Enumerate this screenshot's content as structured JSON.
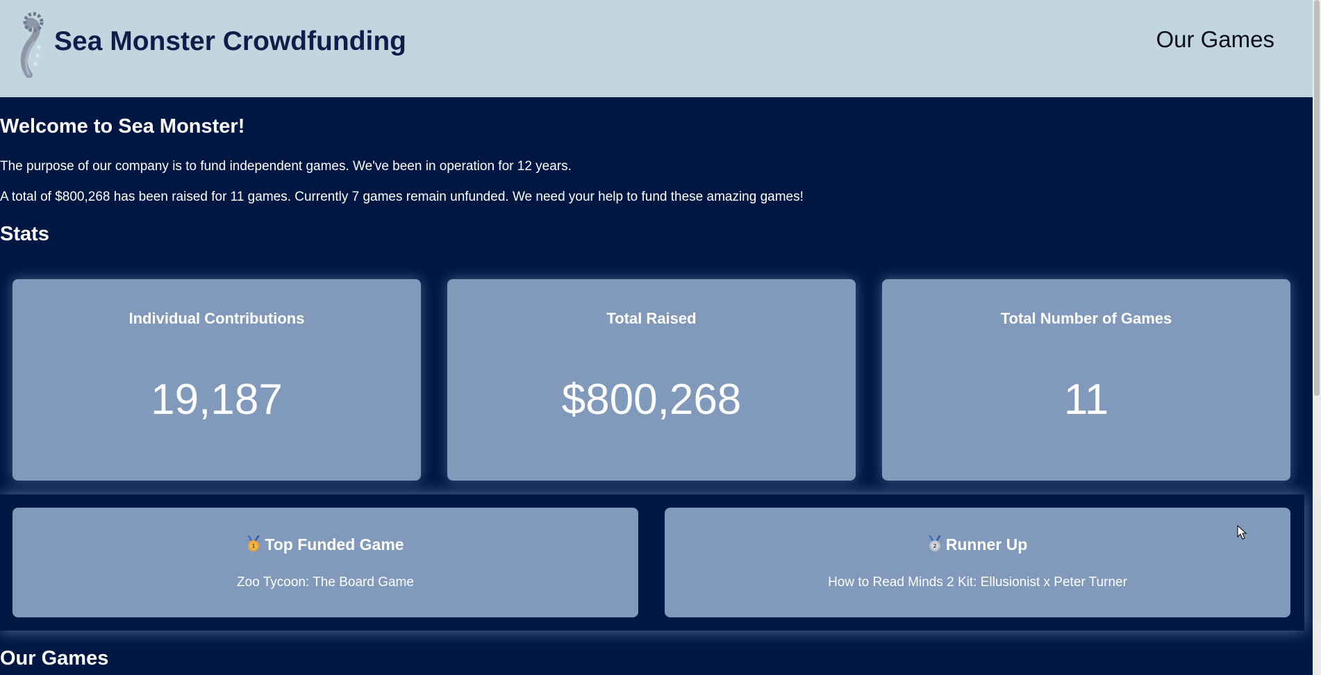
{
  "header": {
    "site_title": "Sea Monster Crowdfunding",
    "nav_link": "Our Games"
  },
  "intro": {
    "heading": "Welcome to Sea Monster!",
    "purpose": "The purpose of our company is to fund independent games. We've been in operation for 12 years.",
    "summary": "A total of $800,268 has been raised for 11 games. Currently 7 games remain unfunded. We need your help to fund these amazing games!"
  },
  "stats": {
    "heading": "Stats",
    "items": [
      {
        "label": "Individual Contributions",
        "value": "19,187"
      },
      {
        "label": "Total Raised",
        "value": "$800,268"
      },
      {
        "label": "Total Number of Games",
        "value": "11"
      }
    ]
  },
  "top_games": {
    "first": {
      "title": "Top Funded Game",
      "game": "Zoo Tycoon: The Board Game",
      "medal_number": "1"
    },
    "second": {
      "title": "Runner Up",
      "game": "How to Read Minds 2 Kit: Ellusionist x Peter Turner",
      "medal_number": "2"
    }
  },
  "games_section": {
    "heading": "Our Games"
  },
  "colors": {
    "header_bg": "#c2d6e0",
    "page_bg": "#001744",
    "card_bg": "#8199ba",
    "title_text": "#0f1d4a"
  },
  "icons": {
    "logo": "sea-monster-tentacle-icon",
    "gold": "gold-medal-icon",
    "silver": "silver-medal-icon",
    "cursor": "mouse-pointer-icon"
  }
}
